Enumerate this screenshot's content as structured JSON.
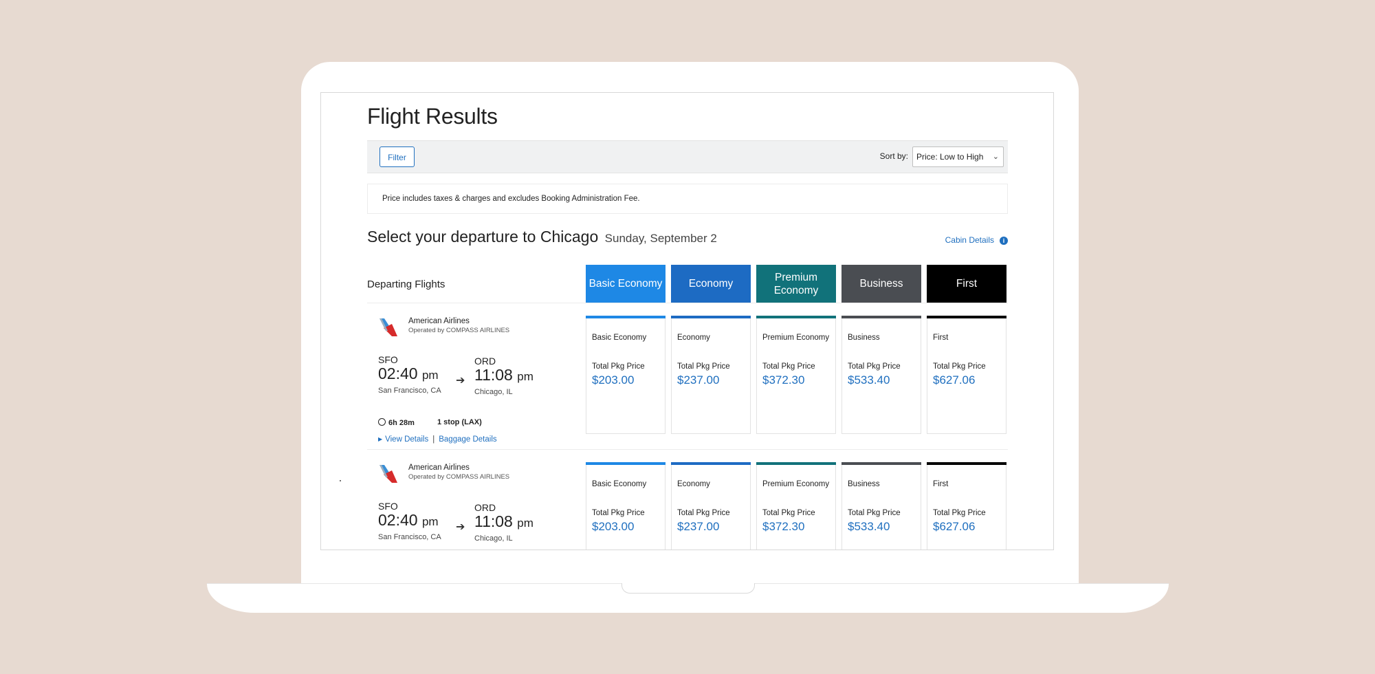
{
  "page": {
    "title": "Flight Results"
  },
  "toolbar": {
    "filter_label": "Filter",
    "sort_label": "Sort by:",
    "sort_value": "Price: Low to High"
  },
  "notice": "Price includes taxes & charges and excludes Booking Administration Fee.",
  "section": {
    "title": "Select your departure to Chicago",
    "date": "Sunday, September 2",
    "cabin_details": "Cabin Details",
    "info_icon": "i"
  },
  "departing_label": "Departing Flights",
  "cabins": [
    {
      "label": "Basic Economy",
      "color": "#1e88e5"
    },
    {
      "label": "Economy",
      "color": "#1d6bc3"
    },
    {
      "label": "Premium Economy",
      "color": "#11727a"
    },
    {
      "label": "Business",
      "color": "#4a4d52"
    },
    {
      "label": "First",
      "color": "#000000"
    }
  ],
  "flights": [
    {
      "airline": "American Airlines",
      "operated_by": "Operated by COMPASS AIRLINES",
      "from_code": "SFO",
      "depart_time": "02:40",
      "depart_ampm": "pm",
      "from_city": "San Francisco, CA",
      "to_code": "ORD",
      "arrive_time": "11:08",
      "arrive_ampm": "pm",
      "to_city": "Chicago, IL",
      "duration": "6h 28m",
      "stops": "1 stop (LAX)",
      "view_details": "View Details",
      "baggage_details": "Baggage Details",
      "fares": [
        {
          "name": "Basic Economy",
          "label": "Total Pkg Price",
          "price": "$203.00"
        },
        {
          "name": "Economy",
          "label": "Total Pkg Price",
          "price": "$237.00"
        },
        {
          "name": "Premium Economy",
          "label": "Total Pkg Price",
          "price": "$372.30"
        },
        {
          "name": "Business",
          "label": "Total Pkg Price",
          "price": "$533.40"
        },
        {
          "name": "First",
          "label": "Total Pkg Price",
          "price": "$627.06"
        }
      ]
    },
    {
      "airline": "American Airlines",
      "operated_by": "Operated by COMPASS AIRLINES",
      "from_code": "SFO",
      "depart_time": "02:40",
      "depart_ampm": "pm",
      "from_city": "San Francisco, CA",
      "to_code": "ORD",
      "arrive_time": "11:08",
      "arrive_ampm": "pm",
      "to_city": "Chicago, IL",
      "fares": [
        {
          "name": "Basic Economy",
          "label": "Total Pkg Price",
          "price": "$203.00"
        },
        {
          "name": "Economy",
          "label": "Total Pkg Price",
          "price": "$237.00"
        },
        {
          "name": "Premium Economy",
          "label": "Total Pkg Price",
          "price": "$372.30"
        },
        {
          "name": "Business",
          "label": "Total Pkg Price",
          "price": "$533.40"
        },
        {
          "name": "First",
          "label": "Total Pkg Price",
          "price": "$627.06"
        }
      ]
    }
  ]
}
